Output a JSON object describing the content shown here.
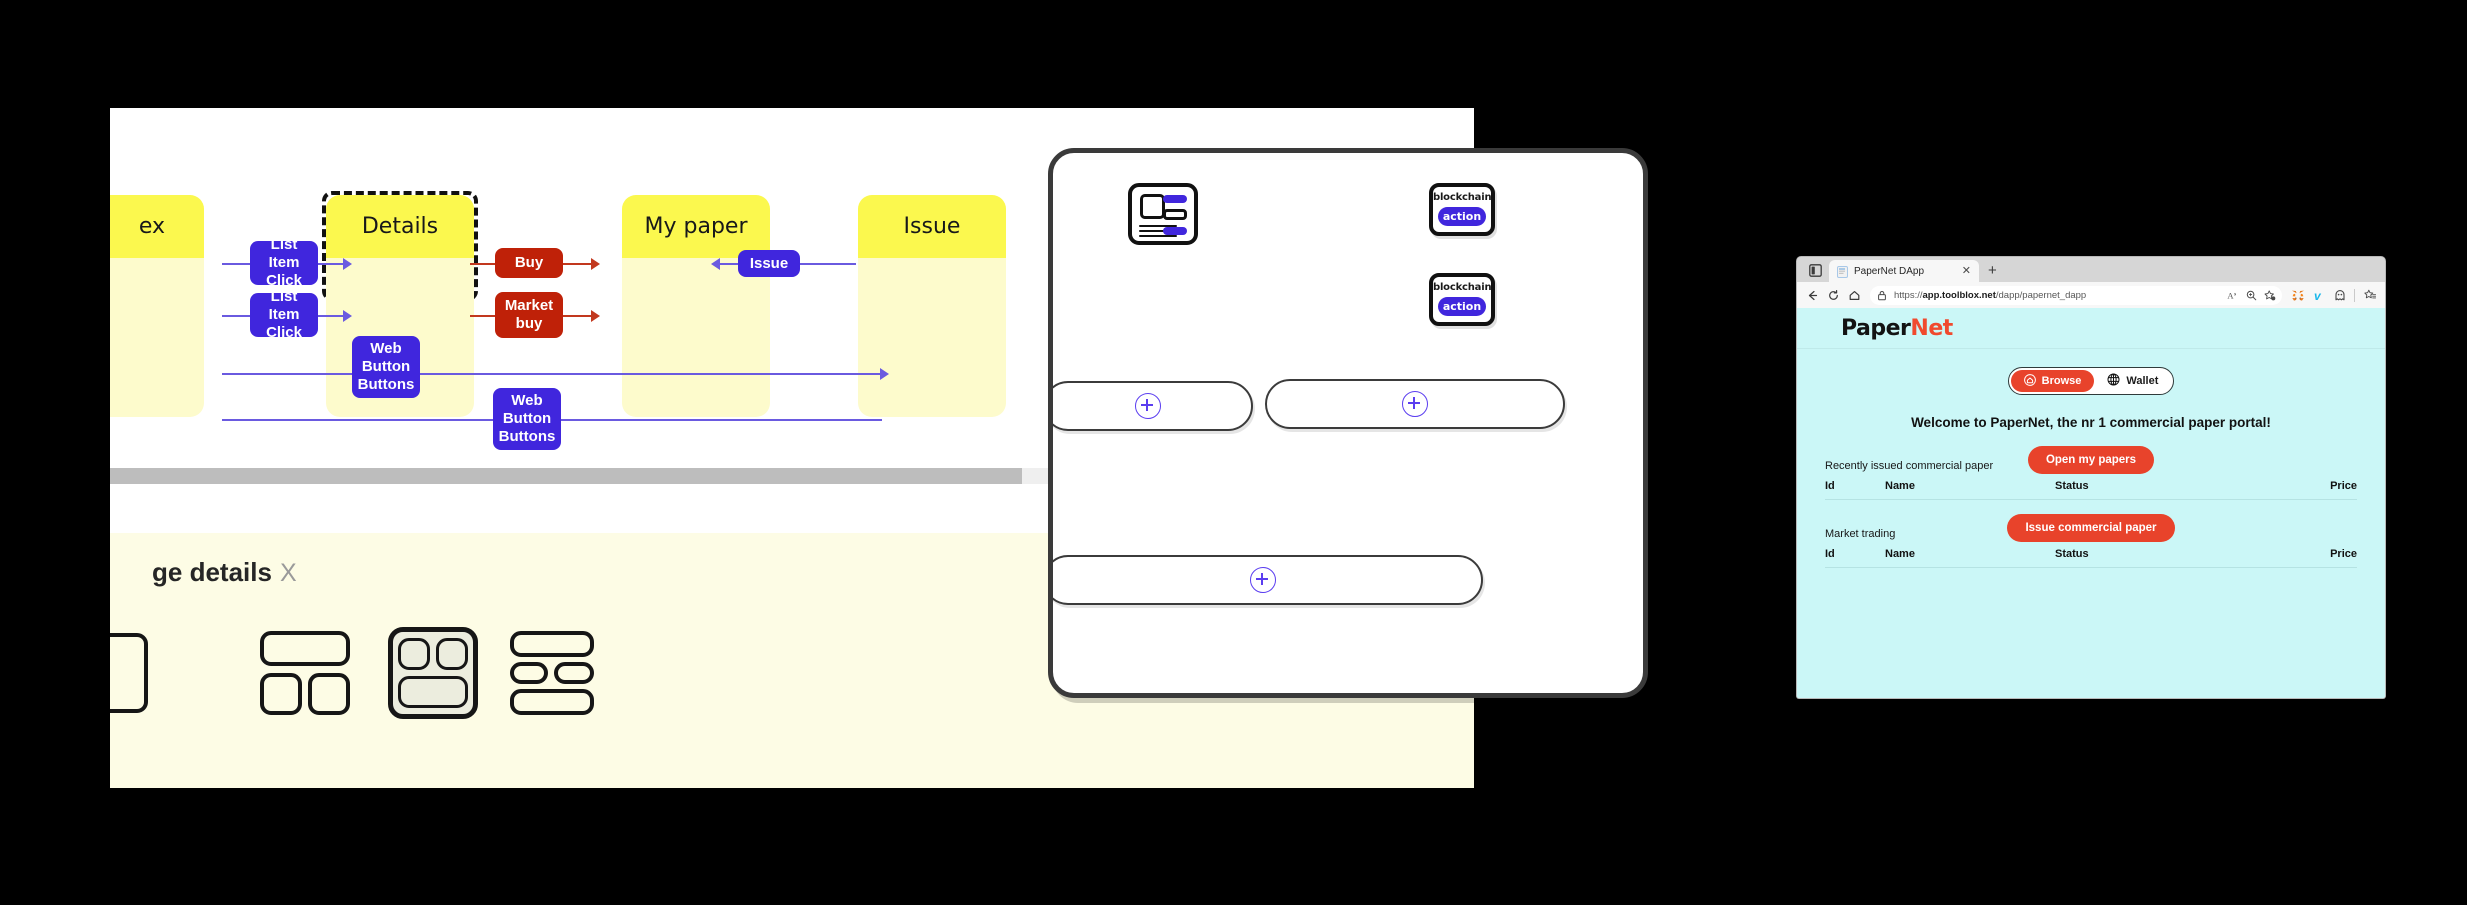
{
  "flow": {
    "lanes": [
      {
        "title": "ex"
      },
      {
        "title": "Details",
        "selected": true
      },
      {
        "title": "My paper"
      },
      {
        "title": "Issue"
      }
    ],
    "chips": [
      {
        "label_lines": [
          "List Item",
          "Click"
        ],
        "color": "blue"
      },
      {
        "label_lines": [
          "List Item",
          "Click"
        ],
        "color": "blue"
      },
      {
        "label_lines": [
          "Web",
          "Button",
          "Buttons"
        ],
        "color": "blue"
      },
      {
        "label_lines": [
          "Web",
          "Button",
          "Buttons"
        ],
        "color": "blue"
      },
      {
        "label_lines": [
          "Buy"
        ],
        "color": "red"
      },
      {
        "label_lines": [
          "Market",
          "buy"
        ],
        "color": "red"
      },
      {
        "label_lines": [
          "Issue"
        ],
        "color": "blue"
      }
    ],
    "colors": {
      "lane_head": "#fbf84e",
      "lane_body": "#fdfbcc",
      "chip_blue": "#4026dd",
      "chip_red": "#bf2108",
      "edge_blue": "#6a5ae0",
      "edge_red": "#c2381e"
    }
  },
  "detail_panel": {
    "title": "ge details",
    "close_label": "X",
    "layout_options": [
      {
        "name": "layout-option-1"
      },
      {
        "name": "layout-option-2"
      },
      {
        "name": "layout-option-3",
        "selected": true
      },
      {
        "name": "layout-option-4"
      }
    ]
  },
  "device": {
    "card_preview_icon": "card-preview-icon",
    "action_cards": [
      {
        "label": "blockchain",
        "button": "action"
      },
      {
        "label": "blockchain",
        "button": "action"
      }
    ],
    "add_slots": [
      {
        "name": "add-slot-left"
      },
      {
        "name": "add-slot-right"
      },
      {
        "name": "add-slot-bottom"
      }
    ],
    "plus_label": "+"
  },
  "browser": {
    "tab": {
      "title": "PaperNet DApp",
      "close_label": "✕"
    },
    "new_tab_label": "+",
    "nav": {
      "back": "←",
      "refresh": "⟳",
      "home": "⌂"
    },
    "url_prefix": "https://",
    "url_bold": "app.toolblox.net",
    "url_rest": "/dapp/papernet_dapp",
    "omni_icons": [
      "lock-icon",
      "read-aloud-icon",
      "zoom-icon",
      "favorite-icon"
    ],
    "extensions": [
      "metamask-icon",
      "vimeo-icon",
      "ghost-icon",
      "collections-icon"
    ]
  },
  "papernet": {
    "logo_part1": "Paper",
    "logo_part2": "Net",
    "segmented": [
      {
        "label": "Browse",
        "icon": "home-icon",
        "active": true
      },
      {
        "label": "Wallet",
        "icon": "globe-icon",
        "active": false
      }
    ],
    "welcome": "Welcome to PaperNet, the nr 1 commercial paper portal!",
    "open_papers_button": "Open my papers",
    "recent_section_label": "Recently issued commercial paper",
    "issue_button": "Issue commercial paper",
    "market_section_label": "Market trading",
    "table_headers": [
      "Id",
      "Name",
      "Status",
      "Price"
    ],
    "accent_color": "#e8432b",
    "page_bg": "#cbf7f7"
  }
}
